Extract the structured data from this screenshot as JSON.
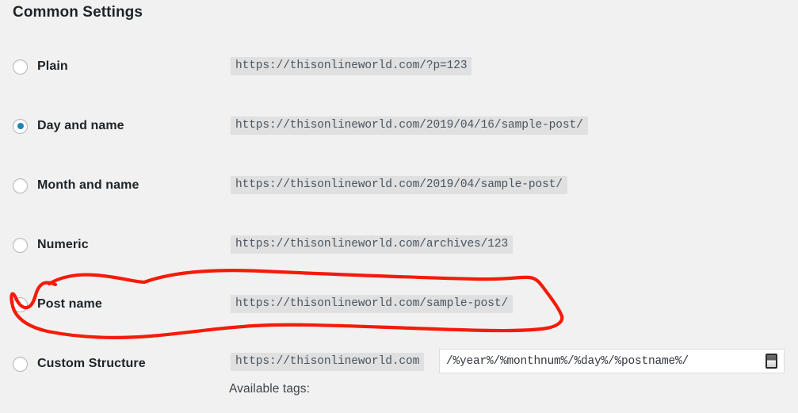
{
  "page": {
    "title": "Common Settings",
    "background_color": "#f1f1f1",
    "accent_color": "#1e87b0",
    "annotation_color": "#f41b08"
  },
  "permalink_options": [
    {
      "id": "plain",
      "label": "Plain",
      "url": "https://thisonlineworld.com/?p=123",
      "selected": false
    },
    {
      "id": "day-and-name",
      "label": "Day and name",
      "url": "https://thisonlineworld.com/2019/04/16/sample-post/",
      "selected": true
    },
    {
      "id": "month-and-name",
      "label": "Month and name",
      "url": "https://thisonlineworld.com/2019/04/sample-post/",
      "selected": false
    },
    {
      "id": "numeric",
      "label": "Numeric",
      "url": "https://thisonlineworld.com/archives/123",
      "selected": false
    },
    {
      "id": "post-name",
      "label": "Post name",
      "url": "https://thisonlineworld.com/sample-post/",
      "selected": false,
      "annotated": true
    }
  ],
  "custom_structure": {
    "label": "Custom Structure",
    "prefix_url": "https://thisonlineworld.com",
    "value": "/%year%/%monthnum%/%day%/%postname%/",
    "selected": false,
    "input_icon": "text-cursor-icon"
  },
  "available_tags": {
    "label": "Available tags:"
  },
  "annotation": {
    "type": "hand-drawn-circle",
    "target": "post-name-row",
    "color": "#f41b08"
  }
}
